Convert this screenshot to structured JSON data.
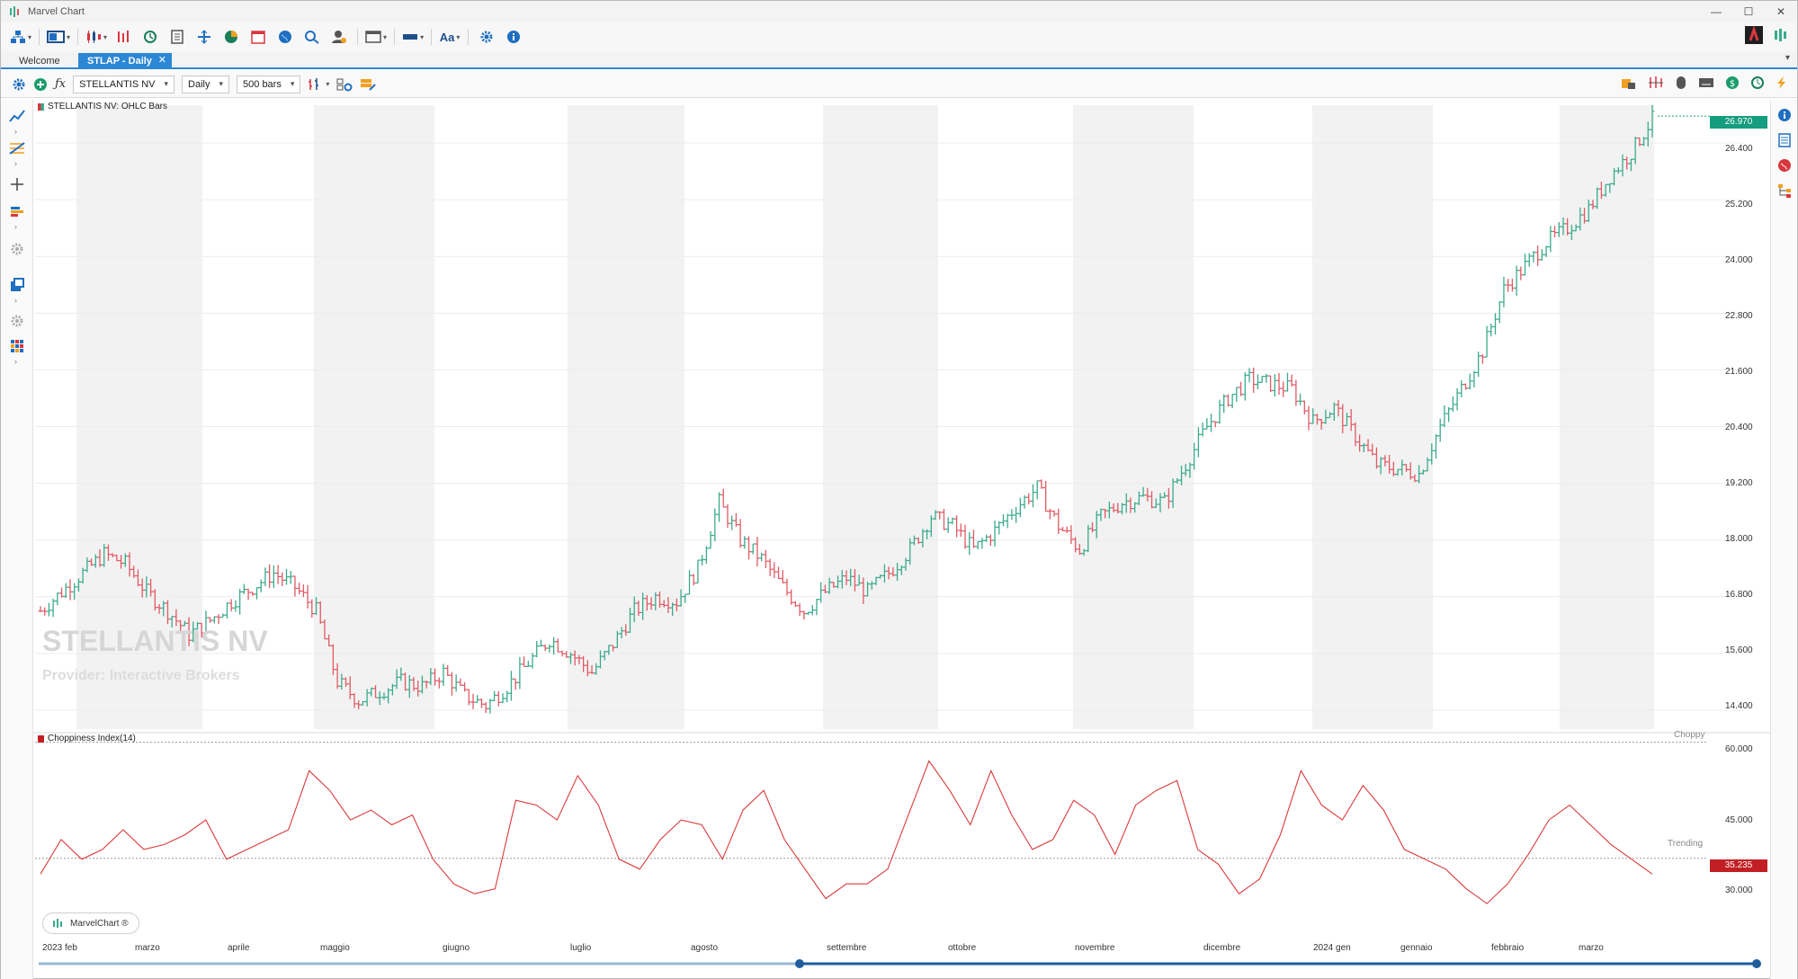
{
  "window": {
    "title": "Marvel Chart",
    "minimize": "—",
    "maximize": "☐",
    "close": "✕"
  },
  "tabs": [
    {
      "label": "Welcome"
    },
    {
      "label": "STLAP - Daily",
      "close": "✕"
    }
  ],
  "chart_toolbar": {
    "symbol": "STELLANTIS NV",
    "timeframe": "Daily",
    "bars": "500 bars"
  },
  "price_pane": {
    "legend": "STELLANTIS NV: OHLC Bars",
    "watermark_name": "STELLANTIS NV",
    "watermark_provider": "Provider: Interactive Brokers",
    "last_price": "26.970",
    "y_ticks": [
      "26.400",
      "25.200",
      "24.000",
      "22.800",
      "21.600",
      "20.400",
      "19.200",
      "18.000",
      "16.800",
      "15.600",
      "14.400"
    ],
    "colors": {
      "up": "#3aaa8c",
      "down": "#e05a64",
      "last_badge": "#169c7e"
    }
  },
  "indicator_pane": {
    "legend": "Choppiness Index(14)",
    "choppy_label": "Choppy",
    "trending_label": "Trending",
    "last_value": "35.235",
    "y_ticks": [
      "60.000",
      "45.000",
      "30.000"
    ],
    "colors": {
      "line": "#d93a3a",
      "last_badge": "#c21f24"
    }
  },
  "x_axis": {
    "labels": [
      "2023 feb",
      "marzo",
      "aprile",
      "maggio",
      "giugno",
      "luglio",
      "agosto",
      "settembre",
      "ottobre",
      "novembre",
      "dicembre",
      "2024 gen",
      "gennaio",
      "febbraio",
      "marzo"
    ]
  },
  "brand": {
    "label": "MarvelChart ®"
  },
  "chart_data": {
    "type": "line",
    "title": "STELLANTIS NV: OHLC Bars",
    "price_close_approx": [
      16.5,
      16.9,
      17.3,
      17.7,
      17.5,
      16.9,
      16.5,
      16.0,
      16.3,
      16.7,
      17.0,
      17.3,
      17.0,
      16.5,
      15.0,
      14.6,
      14.8,
      15.0,
      14.9,
      15.2,
      14.7,
      14.5,
      14.9,
      15.4,
      15.9,
      15.6,
      15.2,
      15.8,
      16.5,
      16.8,
      16.7,
      17.4,
      18.8,
      18.0,
      17.6,
      17.0,
      16.5,
      16.9,
      17.2,
      16.9,
      17.3,
      17.8,
      18.5,
      18.3,
      17.8,
      18.2,
      18.7,
      19.1,
      18.3,
      17.8,
      18.5,
      18.8,
      18.9,
      18.8,
      19.6,
      20.4,
      21.0,
      21.4,
      21.3,
      21.2,
      20.5,
      20.8,
      20.2,
      19.6,
      19.5,
      19.4,
      20.4,
      21.2,
      22.0,
      23.3,
      23.8,
      24.3,
      24.6,
      25.0,
      25.7,
      26.2,
      26.9
    ],
    "choppiness_approx": [
      35,
      42,
      38,
      40,
      44,
      40,
      41,
      43,
      46,
      38,
      40,
      42,
      44,
      56,
      52,
      46,
      48,
      45,
      47,
      38,
      33,
      31,
      32,
      50,
      49,
      46,
      55,
      49,
      38,
      36,
      42,
      46,
      45,
      38,
      48,
      52,
      42,
      36,
      30,
      33,
      33,
      36,
      47,
      58,
      52,
      45,
      56,
      47,
      40,
      42,
      50,
      47,
      39,
      49,
      52,
      54,
      40,
      37,
      31,
      34,
      43,
      56,
      49,
      46,
      53,
      48,
      40,
      38,
      36,
      32,
      29,
      33,
      39,
      46,
      49,
      45,
      41,
      38,
      35
    ],
    "ylim_price": [
      14.0,
      27.2
    ],
    "ylim_chop": [
      25,
      63
    ]
  }
}
